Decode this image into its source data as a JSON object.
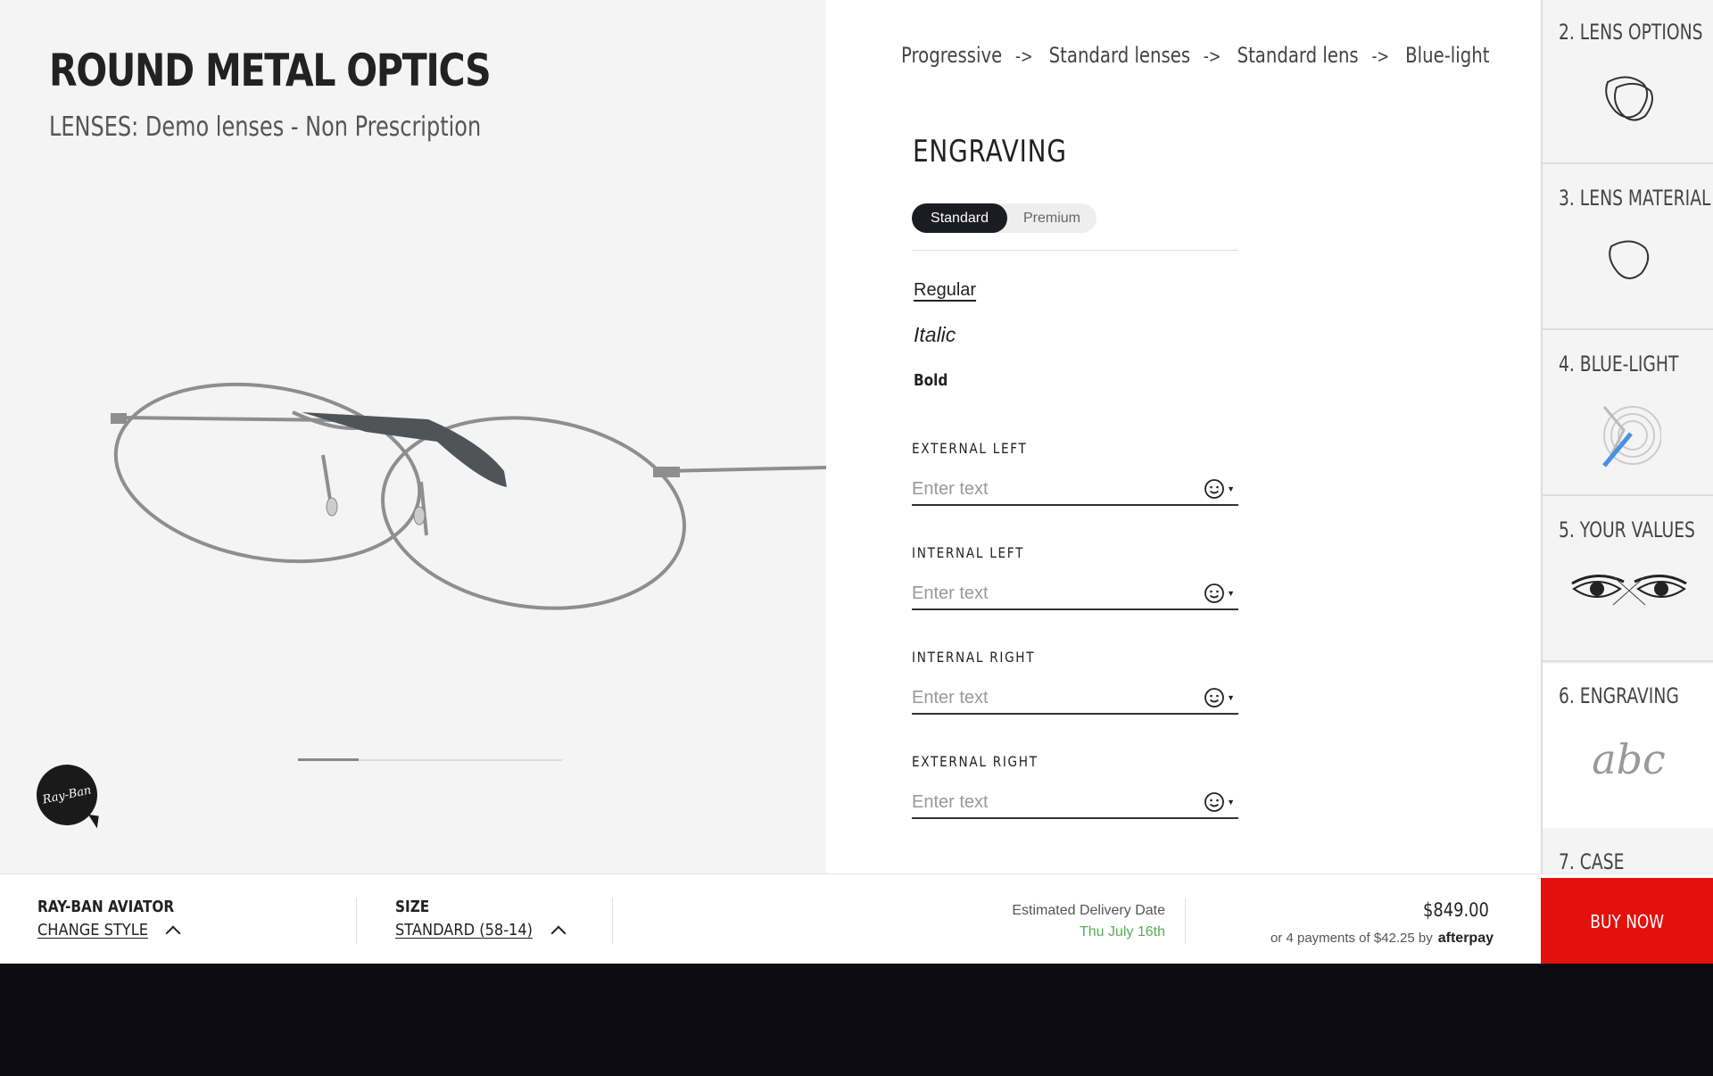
{
  "product": {
    "title": "ROUND METAL OPTICS",
    "lenses": "LENSES: Demo lenses - Non Prescription",
    "logo_text": "Ray-Ban"
  },
  "breadcrumb": {
    "items": [
      "Progressive",
      "Standard lenses",
      "Standard lens",
      "Blue-light"
    ],
    "separator": "->"
  },
  "engraving": {
    "title": "ENGRAVING",
    "tabs": [
      "Standard",
      "Premium"
    ],
    "active_tab": "Standard",
    "font_options": [
      "Regular",
      "Italic",
      "Bold"
    ],
    "selected_font": "Regular",
    "fields": [
      {
        "label": "EXTERNAL LEFT",
        "placeholder": "Enter text",
        "value": ""
      },
      {
        "label": "INTERNAL LEFT",
        "placeholder": "Enter text",
        "value": ""
      },
      {
        "label": "INTERNAL RIGHT",
        "placeholder": "Enter text",
        "value": ""
      },
      {
        "label": "EXTERNAL RIGHT",
        "placeholder": "Enter text",
        "value": ""
      }
    ]
  },
  "steps": [
    {
      "label": "2. LENS OPTIONS",
      "icon": "lens-options-icon"
    },
    {
      "label": "3. LENS MATERIAL",
      "icon": "lens-material-icon"
    },
    {
      "label": "4. BLUE-LIGHT",
      "icon": "blue-light-icon"
    },
    {
      "label": "5. YOUR VALUES",
      "icon": "eyes-icon"
    },
    {
      "label": "6. ENGRAVING",
      "icon": "engraving-abc-icon",
      "active": true,
      "icon_text": "abc"
    },
    {
      "label": "7. CASE",
      "icon": "case-icon"
    }
  ],
  "bottom_bar": {
    "model_label": "RAY-BAN AVIATOR",
    "change_style": "CHANGE STYLE",
    "size_label": "SIZE",
    "size_value": "STANDARD (58-14)",
    "delivery_label": "Estimated Delivery Date",
    "delivery_date": "Thu July 16th",
    "price": "$849.00",
    "installments": "or 4 payments of $42.25 by",
    "afterpay_brand": "afterpay",
    "buy_label": "BUY NOW"
  },
  "colors": {
    "accent_buy": "#e2110b",
    "delivery_green": "#5aaa55",
    "toggle_active": "#1b1b22",
    "blue_light": "#4a90e2"
  },
  "carousel": {
    "current_slide_fraction": 0.23
  }
}
